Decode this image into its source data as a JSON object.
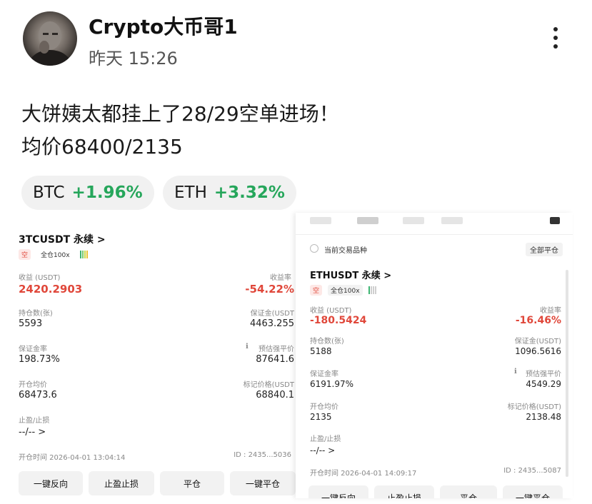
{
  "post": {
    "author": "Crypto大币哥1",
    "time": "昨天 15:26",
    "line1": "大饼姨太都挂上了28/29空单进场！",
    "line2": "均价68400/2135"
  },
  "chips": [
    {
      "symbol": "BTC",
      "change": "+1.96%"
    },
    {
      "symbol": "ETH",
      "change": "+3.32%"
    }
  ],
  "left_card": {
    "title": "3TCUSDT 永续 >",
    "side_tag": "空",
    "margin_tag": "全仓100x",
    "pnl_label": "收益 (USDT)",
    "pnl_value": "2420.2903",
    "roe_label": "收益率",
    "roe_value": "-54.22%",
    "size_label": "持仓数(张)",
    "size_value": "5593",
    "margin_label": "保证金(USDT",
    "margin_value": "4463.255",
    "ratio_label": "保证金率",
    "ratio_value": "198.73%",
    "liq_label": "预估强平价",
    "liq_value": "87641.6",
    "entry_label": "开仓均价",
    "entry_value": "68473.6",
    "mark_label": "标记价格(USDT",
    "mark_value": "68840.1",
    "tpsl_label": "止盈/止损",
    "tpsl_value": "--/--  >",
    "open_time": "开仓时间 2026-04-01 13:04:14",
    "id": "ID : 2435...5036",
    "buttons": [
      "一键反向",
      "止盈止损",
      "平仓",
      "一键平仓"
    ]
  },
  "right_card": {
    "current_pair": "当前交易品种",
    "close_all": "全部平仓",
    "title": "ETHUSDT 永续 >",
    "side_tag": "空",
    "margin_tag": "全仓100x",
    "pnl_label": "收益 (USDT)",
    "pnl_value": "-180.5424",
    "roe_label": "收益率",
    "roe_value": "-16.46%",
    "size_label": "持仓数(张)",
    "size_value": "5188",
    "margin_label": "保证金(USDT)",
    "margin_value": "1096.5616",
    "ratio_label": "保证金率",
    "ratio_value": "6191.97%",
    "liq_label": "预估强平价",
    "liq_value": "4549.29",
    "entry_label": "开仓均价",
    "entry_value": "2135",
    "mark_label": "标记价格(USDT)",
    "mark_value": "2138.48",
    "tpsl_label": "止盈/止损",
    "tpsl_value": "--/--  >",
    "open_time": "开仓时间 2026-04-01 14:09:17",
    "id": "ID : 2435...5087",
    "buttons": [
      "一键反向",
      "止盈止损",
      "平仓",
      "一键平仓"
    ]
  },
  "colors": {
    "up": "#26a65b",
    "down": "#e0473a"
  }
}
